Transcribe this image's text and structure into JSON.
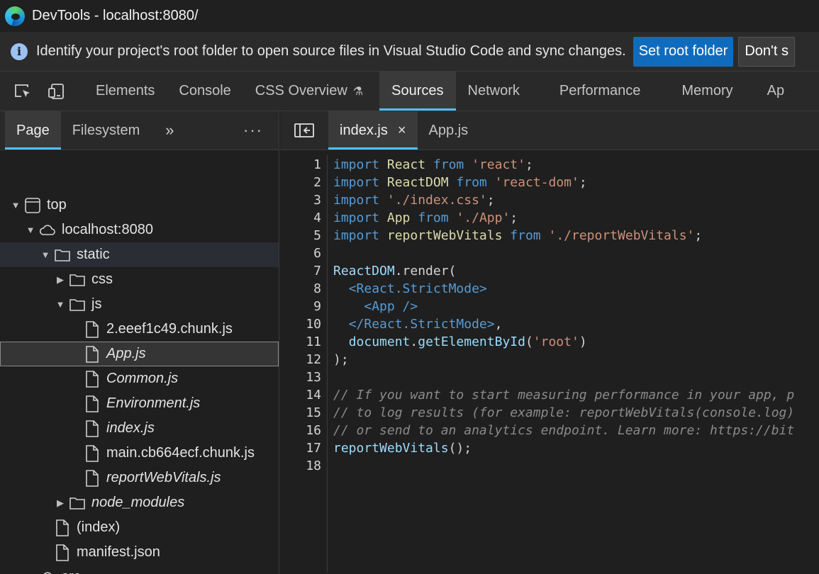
{
  "window": {
    "title": "DevTools - localhost:8080/"
  },
  "infobar": {
    "message": "Identify your project's root folder to open source files in Visual Studio Code and sync changes.",
    "primary_label": "Set root folder",
    "secondary_label": "Don't s"
  },
  "toolbar": {
    "tabs": [
      "Elements",
      "Console",
      "CSS Overview",
      "Sources",
      "Network",
      "Performance",
      "Memory",
      "Ap"
    ],
    "active": "Sources"
  },
  "navigator": {
    "tabs": [
      "Page",
      "Filesystem"
    ],
    "more": "»",
    "menu": "⋮",
    "tree": [
      {
        "label": "top",
        "level": 0,
        "type": "frame",
        "expanded": true
      },
      {
        "label": "localhost:8080",
        "level": 1,
        "type": "cloud",
        "expanded": true
      },
      {
        "label": "static",
        "level": 2,
        "type": "folder",
        "expanded": true
      },
      {
        "label": "css",
        "level": 3,
        "type": "folder",
        "expanded": false
      },
      {
        "label": "js",
        "level": 3,
        "type": "folder",
        "expanded": true
      },
      {
        "label": "2.eeef1c49.chunk.js",
        "level": 4,
        "type": "file"
      },
      {
        "label": "App.js",
        "level": 4,
        "type": "file",
        "italic": true,
        "selected": true
      },
      {
        "label": "Common.js",
        "level": 4,
        "type": "file",
        "italic": true
      },
      {
        "label": "Environment.js",
        "level": 4,
        "type": "file",
        "italic": true
      },
      {
        "label": "index.js",
        "level": 4,
        "type": "file",
        "italic": true
      },
      {
        "label": "main.cb664ecf.chunk.js",
        "level": 4,
        "type": "file"
      },
      {
        "label": "reportWebVitals.js",
        "level": 4,
        "type": "file",
        "italic": true
      },
      {
        "label": "node_modules",
        "level": 3,
        "type": "folder",
        "expanded": false,
        "italic": true
      },
      {
        "label": "(index)",
        "level": 2,
        "type": "file"
      },
      {
        "label": "manifest.json",
        "level": 2,
        "type": "file"
      },
      {
        "label": "src",
        "level": 1,
        "type": "cloud",
        "expanded": false
      }
    ]
  },
  "editor": {
    "tabs": [
      {
        "label": "index.js",
        "active": true,
        "close": "×"
      },
      {
        "label": "App.js",
        "active": false
      }
    ],
    "lines": [
      [
        [
          "kw",
          "import"
        ],
        [
          "plain",
          " "
        ],
        [
          "fn",
          "React"
        ],
        [
          "plain",
          " "
        ],
        [
          "kw",
          "from"
        ],
        [
          "plain",
          " "
        ],
        [
          "str",
          "'react'"
        ],
        [
          "plain",
          ";"
        ]
      ],
      [
        [
          "kw",
          "import"
        ],
        [
          "plain",
          " "
        ],
        [
          "fn",
          "ReactDOM"
        ],
        [
          "plain",
          " "
        ],
        [
          "kw",
          "from"
        ],
        [
          "plain",
          " "
        ],
        [
          "str",
          "'react-dom'"
        ],
        [
          "plain",
          ";"
        ]
      ],
      [
        [
          "kw",
          "import"
        ],
        [
          "plain",
          " "
        ],
        [
          "str",
          "'./index.css'"
        ],
        [
          "plain",
          ";"
        ]
      ],
      [
        [
          "kw",
          "import"
        ],
        [
          "plain",
          " "
        ],
        [
          "fn",
          "App"
        ],
        [
          "plain",
          " "
        ],
        [
          "kw",
          "from"
        ],
        [
          "plain",
          " "
        ],
        [
          "str",
          "'./App'"
        ],
        [
          "plain",
          ";"
        ]
      ],
      [
        [
          "kw",
          "import"
        ],
        [
          "plain",
          " "
        ],
        [
          "fn",
          "reportWebVitals"
        ],
        [
          "plain",
          " "
        ],
        [
          "kw",
          "from"
        ],
        [
          "plain",
          " "
        ],
        [
          "str",
          "'./reportWebVitals'"
        ],
        [
          "plain",
          ";"
        ]
      ],
      [],
      [
        [
          "id",
          "ReactDOM"
        ],
        [
          "plain",
          ".render("
        ]
      ],
      [
        [
          "plain",
          "  "
        ],
        [
          "tag",
          "<React.StrictMode>"
        ]
      ],
      [
        [
          "plain",
          "    "
        ],
        [
          "tag",
          "<App />"
        ]
      ],
      [
        [
          "plain",
          "  "
        ],
        [
          "tag",
          "</React.StrictMode>"
        ],
        [
          "plain",
          ","
        ]
      ],
      [
        [
          "plain",
          "  "
        ],
        [
          "id",
          "document"
        ],
        [
          "plain",
          "."
        ],
        [
          "id",
          "getElementById"
        ],
        [
          "plain",
          "("
        ],
        [
          "str",
          "'root'"
        ],
        [
          "plain",
          ")"
        ]
      ],
      [
        [
          "plain",
          ");"
        ]
      ],
      [],
      [
        [
          "cmt",
          "// If you want to start measuring performance in your app, p"
        ]
      ],
      [
        [
          "cmt",
          "// to log results (for example: reportWebVitals(console.log)"
        ]
      ],
      [
        [
          "cmt",
          "// or send to an analytics endpoint. Learn more: https://bit"
        ]
      ],
      [
        [
          "id",
          "reportWebVitals"
        ],
        [
          "plain",
          "();"
        ]
      ],
      []
    ]
  }
}
